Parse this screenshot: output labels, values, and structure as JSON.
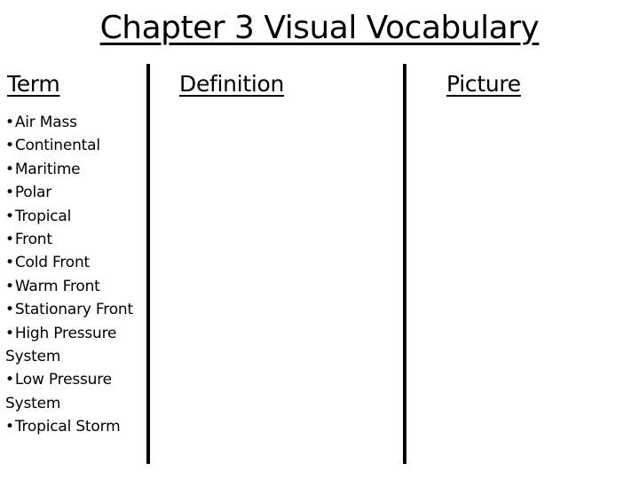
{
  "title": "Chapter 3 Visual Vocabulary",
  "columns": {
    "term": "Term",
    "definition": "Definition",
    "picture": "Picture"
  },
  "bullet_glyph": "•",
  "terms": [
    "Air Mass",
    "Continental",
    "Maritime",
    "Polar",
    "Tropical",
    "Front",
    "Cold Front",
    "Warm Front",
    "Stationary Front",
    "High Pressure System",
    "Low Pressure System",
    "Tropical Storm"
  ]
}
